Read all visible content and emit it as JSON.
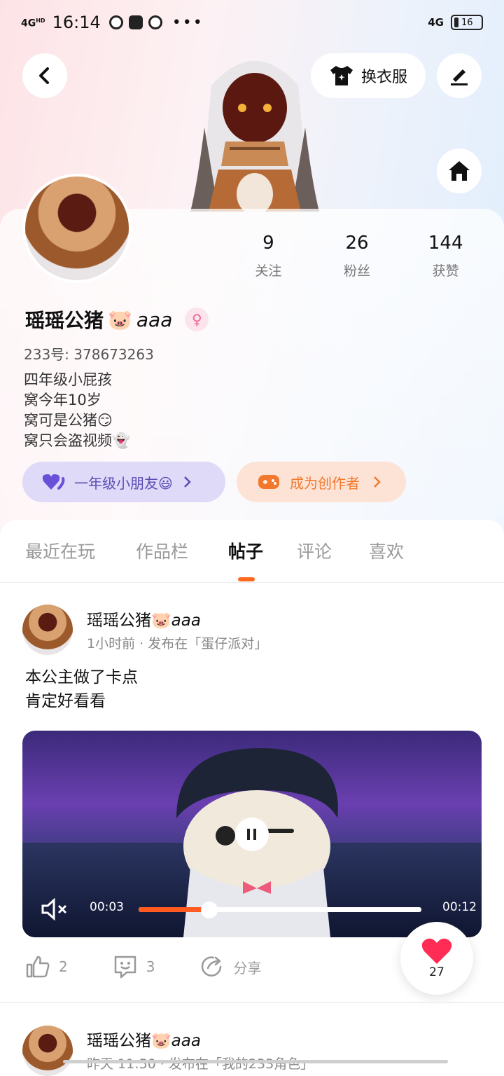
{
  "status_bar": {
    "network": "4G",
    "network_sup": "HD",
    "time": "16:14",
    "more": "•••",
    "right_network": "4G",
    "battery": "16"
  },
  "header": {
    "dress_up_label": "换衣服"
  },
  "stats": [
    {
      "value": "9",
      "label": "关注"
    },
    {
      "value": "26",
      "label": "粉丝"
    },
    {
      "value": "144",
      "label": "获赞"
    }
  ],
  "profile": {
    "name": "瑶瑶公猪",
    "name_suffix": "aaa",
    "name_emoji": "🐷",
    "gender_symbol": "♀",
    "uid": "233号: 378673263",
    "bio": [
      "四年级小屁孩",
      "窝今年10岁",
      "窝可是公猪😏",
      "窝只会盗视频👻"
    ]
  },
  "chips": [
    {
      "label": "一年级小朋友😃",
      "color": "#5b4db4"
    },
    {
      "label": "成为创作者",
      "color": "#f3782c"
    }
  ],
  "tabs": [
    "最近在玩",
    "作品栏",
    "帖子",
    "评论",
    "喜欢"
  ],
  "active_tab": "帖子",
  "posts": [
    {
      "author": "瑶瑶公猪",
      "author_suffix": "aaa",
      "meta": "1小时前 · 发布在「蛋仔派对」",
      "text_lines": [
        "本公主做了卡点",
        "肯定好看看"
      ],
      "video": {
        "current": "00:03",
        "duration": "00:12",
        "progress": 0.25
      },
      "likes": "2",
      "comments": "3",
      "share_label": "分享"
    },
    {
      "author": "瑶瑶公猪",
      "author_suffix": "aaa",
      "meta": "昨天 11:50 · 发布在「我的233角色」"
    }
  ],
  "heart_count": "27",
  "colors": {
    "accent": "#ff6a1f",
    "heart": "#ff2d55"
  }
}
